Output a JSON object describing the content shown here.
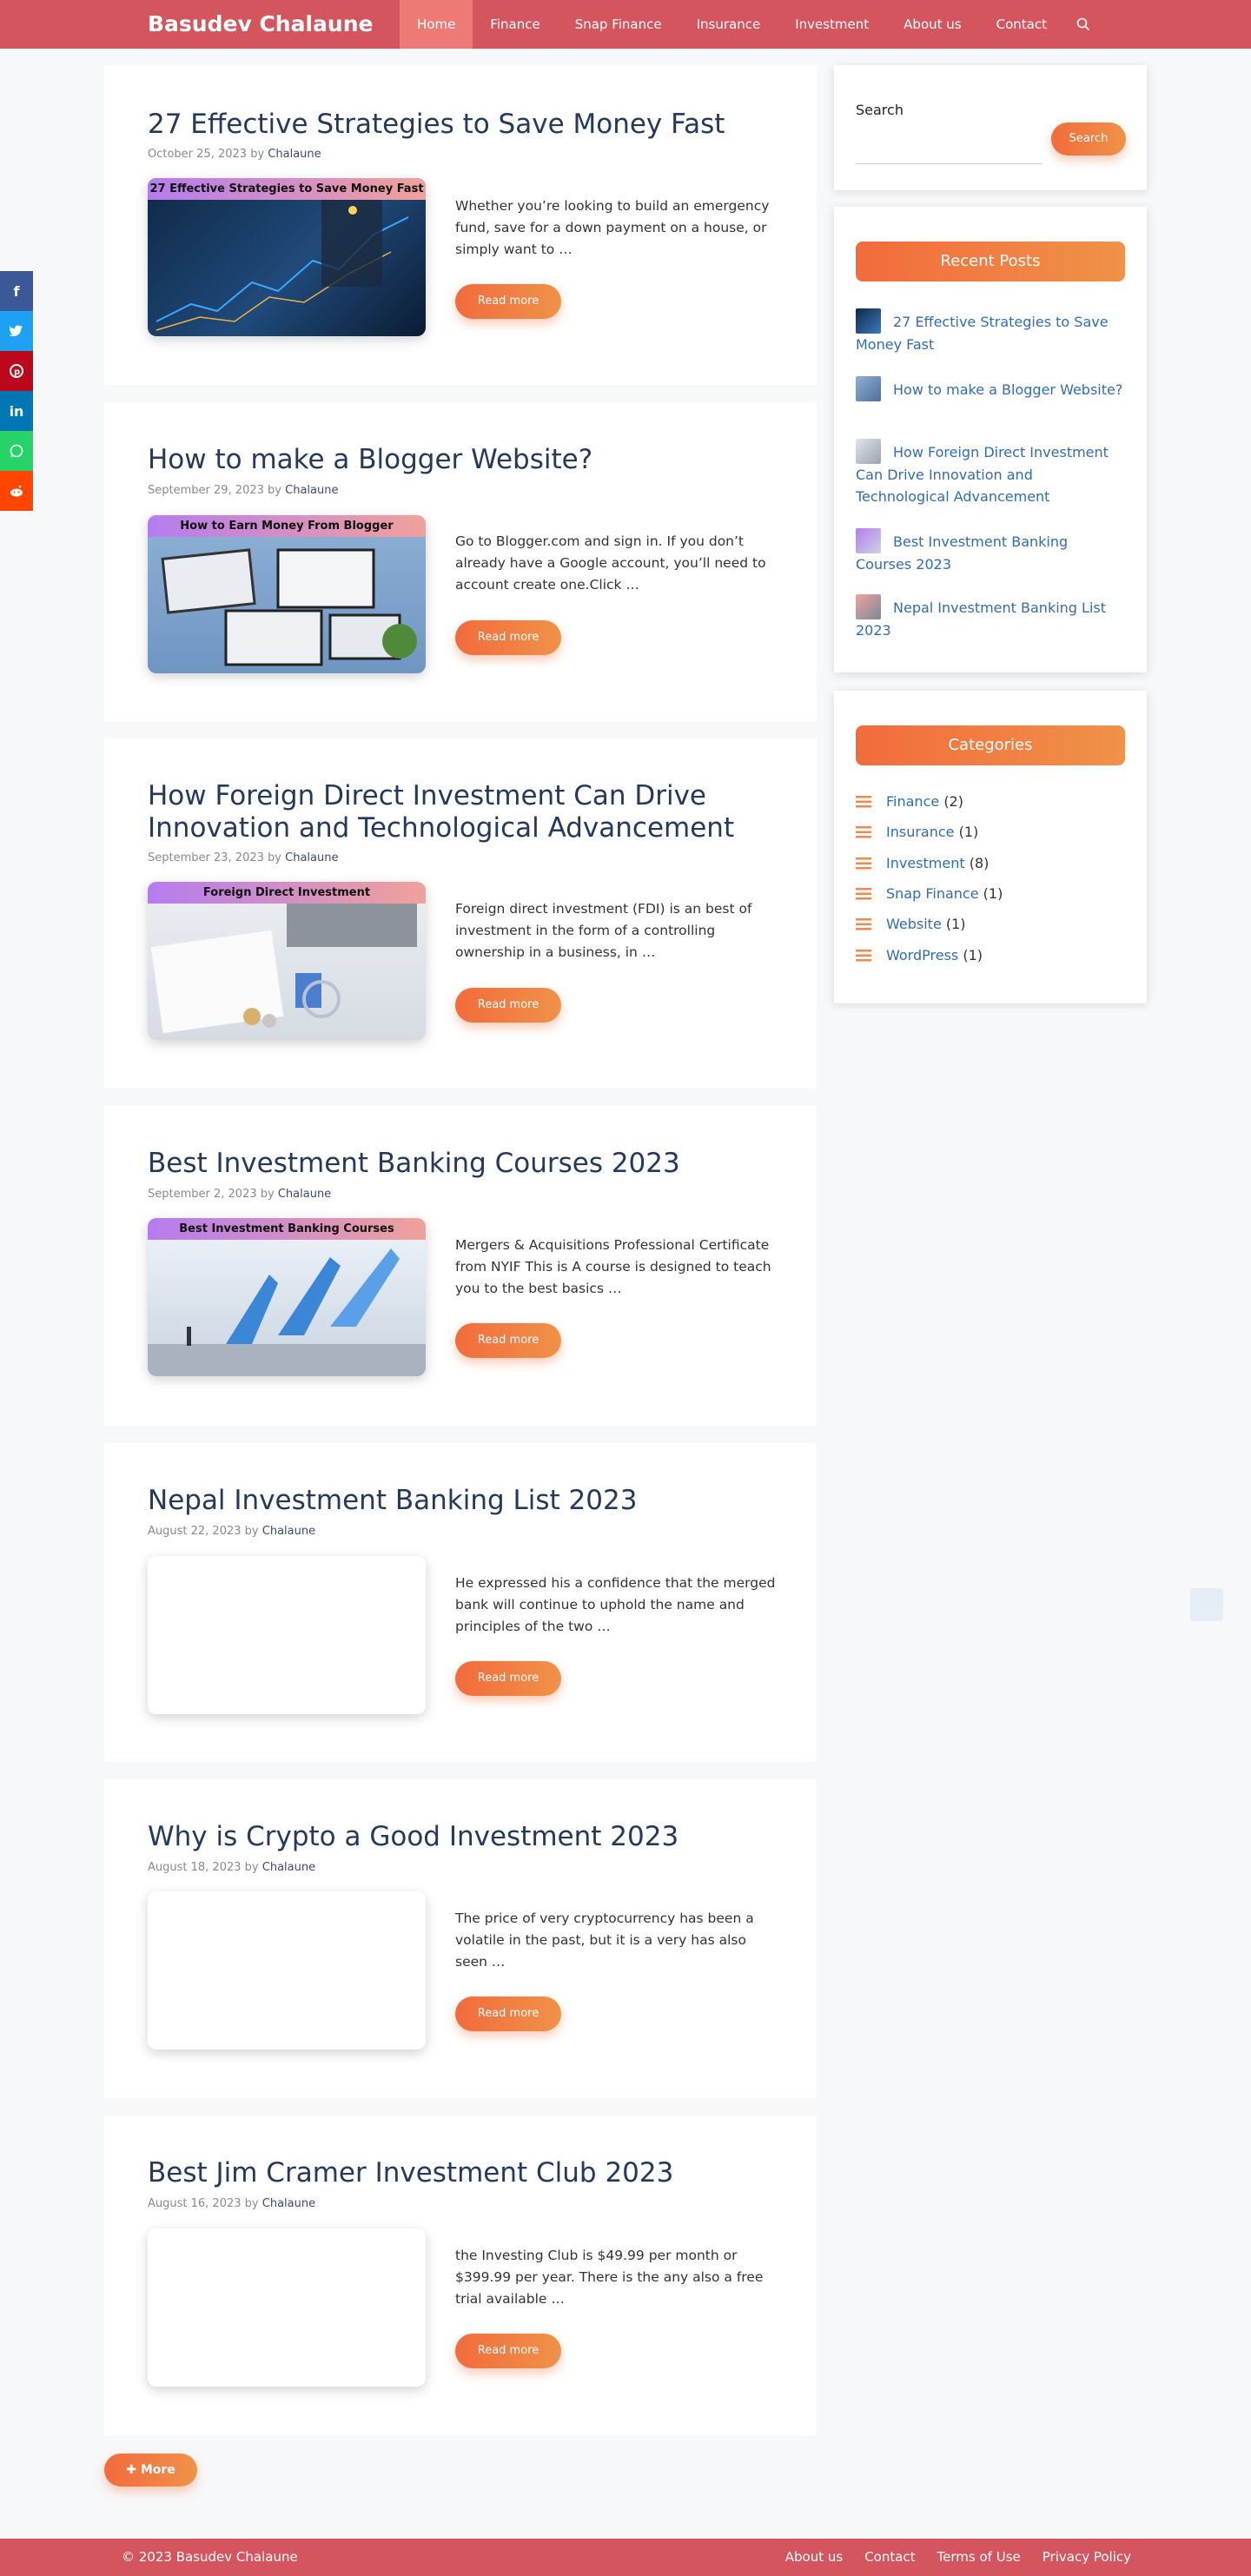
{
  "site": {
    "title": "Basudev Chalaune"
  },
  "nav": {
    "items": [
      "Home",
      "Finance",
      "Snap Finance",
      "Insurance",
      "Investment",
      "About us",
      "Contact"
    ],
    "search_icon": "search-icon"
  },
  "share": {
    "icons": [
      "facebook-icon",
      "twitter-icon",
      "pinterest-icon",
      "linkedin-icon",
      "whatsapp-icon",
      "reddit-icon"
    ],
    "colors": [
      "#3b5998",
      "#1da1f2",
      "#bd081c",
      "#0077b5",
      "#25d366",
      "#ff4500"
    ]
  },
  "posts": [
    {
      "title": "27 Effective Strategies to Save Money Fast",
      "date": "October 25, 2023",
      "by": "by",
      "author": "Chalaune",
      "thumb_text": "27 Effective Strategies to Save Money Fast",
      "excerpt": "Whether you’re looking to build an emergency fund, save for a down payment on a house, or simply want to …",
      "read_more": "Read more"
    },
    {
      "title": "How to make a Blogger Website?",
      "date": "September 29, 2023",
      "by": "by",
      "author": "Chalaune",
      "thumb_text": "How to Earn Money From Blogger",
      "excerpt": "Go to Blogger.com and sign in. If you don’t already have a Google account, you’ll need to account create one.Click …",
      "read_more": "Read more"
    },
    {
      "title": "How Foreign Direct Investment Can Drive Innovation and Technological Advancement",
      "date": "September 23, 2023",
      "by": "by",
      "author": "Chalaune",
      "thumb_text": "Foreign Direct Investment",
      "excerpt": "Foreign direct investment (FDI) is an best of investment in the form of a controlling ownership in a business, in …",
      "read_more": "Read more"
    },
    {
      "title": "Best Investment Banking Courses 2023",
      "date": "September 2, 2023",
      "by": "by",
      "author": "Chalaune",
      "thumb_text": "Best Investment Banking Courses",
      "excerpt": "Mergers & Acquisitions Professional Certificate from NYIF This is A course is designed to teach you to the best basics …",
      "read_more": "Read more"
    },
    {
      "title": "Nepal Investment Banking List 2023",
      "date": "August 22, 2023",
      "by": "by",
      "author": "Chalaune",
      "thumb_text": "",
      "excerpt": "He expressed his a confidence that the merged bank will continue to uphold the name and principles of the two …",
      "read_more": "Read more"
    },
    {
      "title": "Why is Crypto a Good Investment 2023",
      "date": "August 18, 2023",
      "by": "by",
      "author": "Chalaune",
      "thumb_text": "",
      "excerpt": "The price of very cryptocurrency has been a volatile in the past, but it is a very has also seen …",
      "read_more": "Read more"
    },
    {
      "title": "Best Jim Cramer Investment Club 2023",
      "date": "August 16, 2023",
      "by": "by",
      "author": "Chalaune",
      "thumb_text": "",
      "excerpt": "the Investing Club is $49.99 per month or $399.99 per year. There is the any also a free trial available …",
      "read_more": "Read more"
    }
  ],
  "more_button": "More",
  "sidebar": {
    "search": {
      "label": "Search",
      "button": "Search",
      "value": ""
    },
    "recent": {
      "title": "Recent Posts",
      "items": [
        "27 Effective Strategies to Save Money Fast",
        "How to make a Blogger Website?",
        "How Foreign Direct Investment Can Drive Innovation and Technological Advancement",
        "Best Investment Banking Courses 2023",
        "Nepal Investment Banking List 2023"
      ]
    },
    "categories": {
      "title": "Categories",
      "items": [
        {
          "name": "Finance",
          "count": "(2)"
        },
        {
          "name": "Insurance",
          "count": "(1)"
        },
        {
          "name": "Investment",
          "count": "(8)"
        },
        {
          "name": "Snap Finance",
          "count": "(1)"
        },
        {
          "name": "Website",
          "count": "(1)"
        },
        {
          "name": "WordPress",
          "count": "(1)"
        }
      ]
    }
  },
  "footer": {
    "copyright": "© 2023 Basudev Chalaune",
    "links": [
      "About us",
      "Contact",
      "Terms of Use",
      "Privacy Policy"
    ]
  },
  "colors": {
    "header": "#d5555e",
    "accent": "#f26b3c",
    "link": "#2f6db8",
    "title": "#233a5e"
  }
}
